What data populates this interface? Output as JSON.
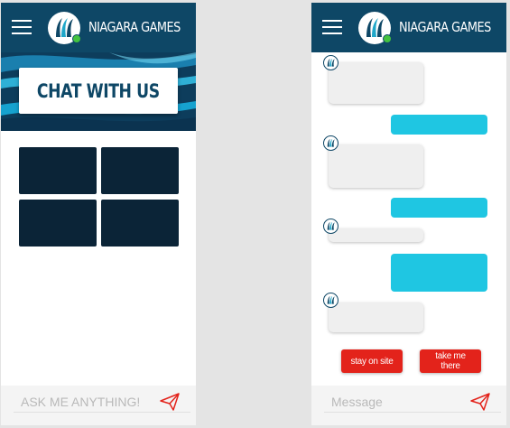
{
  "brand": {
    "name": "NIAGARA GAMES"
  },
  "left_screen": {
    "hero_title": "CHAT WITH US",
    "input_placeholder": "ASK ME ANYTHING!",
    "tiles": [
      "",
      "",
      "",
      ""
    ]
  },
  "right_screen": {
    "messages": [
      {
        "from": "bot",
        "text": ""
      },
      {
        "from": "user",
        "text": ""
      },
      {
        "from": "bot",
        "text": ""
      },
      {
        "from": "user",
        "text": ""
      },
      {
        "from": "bot",
        "text": ""
      },
      {
        "from": "user",
        "text": ""
      },
      {
        "from": "bot",
        "text": ""
      }
    ],
    "buttons": {
      "stay": "stay on site",
      "take": "take me there"
    },
    "input_placeholder": "Message"
  },
  "colors": {
    "header": "#0e4766",
    "tile": "#0b2437",
    "user_bubble": "#1fc6e2",
    "bot_bubble": "#efefef",
    "action_button": "#e3231b",
    "online_dot": "#43c33f"
  },
  "icons": [
    "menu-icon",
    "niagara-logo-icon",
    "send-icon",
    "bot-avatar-icon"
  ]
}
